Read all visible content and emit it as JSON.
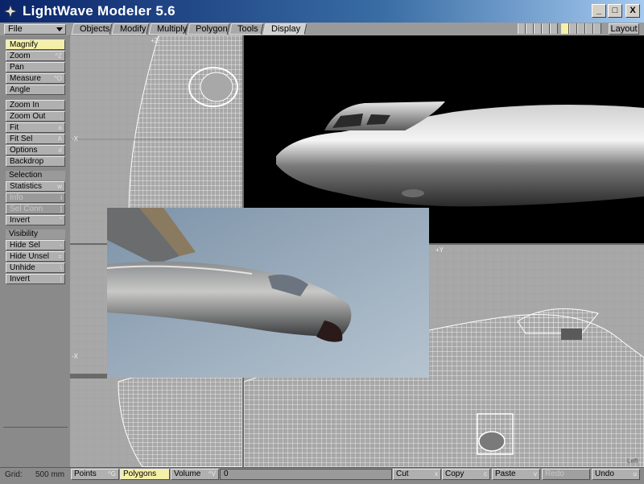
{
  "window": {
    "title": "LightWave Modeler 5.6",
    "minimize": "_",
    "maximize": "□",
    "close": "X"
  },
  "menu": {
    "file": "File"
  },
  "tabs": [
    {
      "label": "Objects"
    },
    {
      "label": "Modify"
    },
    {
      "label": "Multiply"
    },
    {
      "label": "Polygon"
    },
    {
      "label": "Tools"
    },
    {
      "label": "Display",
      "active": true
    }
  ],
  "layout_button": "Layout",
  "tools": {
    "view": [
      {
        "label": "Magnify",
        "key": "",
        "active": true
      },
      {
        "label": "Zoom",
        "key": "^Z"
      },
      {
        "label": "Pan",
        "key": ""
      },
      {
        "label": "Measure",
        "key": "^O"
      },
      {
        "label": "Angle",
        "key": ""
      }
    ],
    "fit": [
      {
        "label": "Zoom In",
        "key": "."
      },
      {
        "label": "Zoom Out",
        "key": ","
      },
      {
        "label": "Fit",
        "key": "a"
      },
      {
        "label": "Fit Sel",
        "key": "A"
      },
      {
        "label": "Options",
        "key": "d"
      },
      {
        "label": "Backdrop",
        "key": ""
      }
    ],
    "selection_header": "Selection",
    "selection": [
      {
        "label": "Statistics",
        "key": "w"
      },
      {
        "label": "Info",
        "key": "i",
        "disabled": true
      },
      {
        "label": "Sel Conn",
        "key": "]",
        "disabled": true
      },
      {
        "label": "Invert",
        "key": "\""
      }
    ],
    "visibility_header": "Visibility",
    "visibility": [
      {
        "label": "Hide Sel",
        "key": "-"
      },
      {
        "label": "Hide Unsel",
        "key": "="
      },
      {
        "label": "Unhide",
        "key": "\\"
      },
      {
        "label": "Invert",
        "key": "|"
      }
    ]
  },
  "viewports": {
    "top_axis_z": "+Z",
    "top_axis_x": "-X",
    "front_axis_y": "+Y",
    "front_axis_x": "-X",
    "side_axis_y": "+Y",
    "side_label": "Left"
  },
  "status": {
    "grid_label": "Grid:",
    "grid_value": "500 mm",
    "modes": [
      {
        "label": "Points",
        "key": "^G"
      },
      {
        "label": "Polygons",
        "key": "",
        "active": true
      },
      {
        "label": "Volume",
        "key": "^V"
      }
    ],
    "count": "0",
    "edit": [
      {
        "label": "Cut",
        "key": "x"
      },
      {
        "label": "Copy",
        "key": "c"
      },
      {
        "label": "Paste",
        "key": "v"
      },
      {
        "label": "Redo",
        "key": "",
        "disabled": true
      },
      {
        "label": "Undo",
        "key": "u"
      }
    ]
  },
  "colors": {
    "title_start": "#0a246a",
    "title_end": "#a6caf0",
    "highlight": "#f5f0a8",
    "panel": "#8a8a8a"
  }
}
